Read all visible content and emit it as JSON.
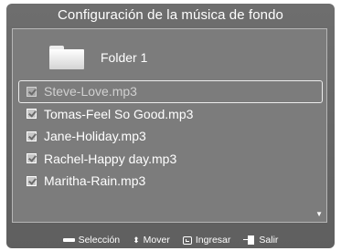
{
  "title": "Configuración de la música de fondo",
  "folder": {
    "label": "Folder 1",
    "icon": "folder-icon"
  },
  "files": [
    {
      "name": "Steve-Love.mp3",
      "checked": true,
      "selected": true
    },
    {
      "name": "Tomas-Feel So Good.mp3",
      "checked": true,
      "selected": false
    },
    {
      "name": "Jane-Holiday.mp3",
      "checked": true,
      "selected": false
    },
    {
      "name": "Rachel-Happy day.mp3",
      "checked": true,
      "selected": false
    },
    {
      "name": "Maritha-Rain.mp3",
      "checked": true,
      "selected": false
    }
  ],
  "footer": {
    "select": {
      "icon": "bar-key-icon",
      "label": "Selección"
    },
    "move": {
      "icon": "up-down-icon",
      "label": "Mover"
    },
    "enter": {
      "icon": "enter-key-icon",
      "label": "Ingresar"
    },
    "exit": {
      "icon": "exit-key-icon",
      "label": "Salir"
    }
  },
  "colors": {
    "background": "#666666",
    "panel": "#7c7c7c",
    "text": "#ffffff",
    "selected_text": "#d0d0d0"
  }
}
